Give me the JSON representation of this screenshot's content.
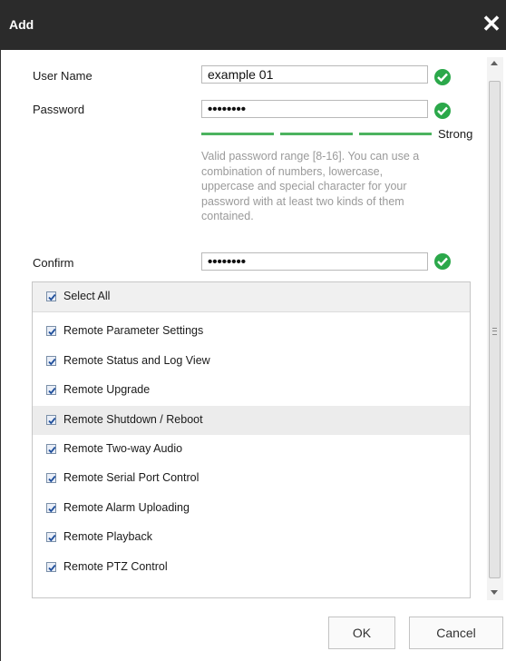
{
  "dialog": {
    "title": "Add",
    "close_glyph": "✕"
  },
  "form": {
    "user_name": {
      "label": "User Name",
      "value": "example 01",
      "status_icon": "check-circle-icon"
    },
    "password": {
      "label": "Password",
      "value": "••••••••",
      "status_icon": "check-circle-icon"
    },
    "strength": {
      "label": "Strong",
      "level": 1.0,
      "color": "#4cb35f"
    },
    "hint": "Valid password range [8-16]. You can use a combination of numbers, lowercase, uppercase and special character for your password with at least two kinds of them contained.",
    "confirm": {
      "label": "Confirm",
      "value": "••••••••",
      "status_icon": "check-circle-icon"
    }
  },
  "permissions": {
    "select_all": {
      "label": "Select All",
      "checked": true
    },
    "items": [
      {
        "label": "Remote Parameter Settings",
        "checked": true
      },
      {
        "label": "Remote Status and Log View",
        "checked": true
      },
      {
        "label": "Remote Upgrade",
        "checked": true
      },
      {
        "label": "Remote Shutdown / Reboot",
        "checked": true,
        "highlighted": true
      },
      {
        "label": "Remote Two-way Audio",
        "checked": true
      },
      {
        "label": "Remote Serial Port Control",
        "checked": true
      },
      {
        "label": "Remote Alarm Uploading",
        "checked": true
      },
      {
        "label": "Remote Playback",
        "checked": true
      },
      {
        "label": "Remote PTZ Control",
        "checked": true
      }
    ]
  },
  "buttons": {
    "ok": "OK",
    "cancel": "Cancel"
  },
  "colors": {
    "titlebar": "#2b2b2b",
    "success": "#2ba84a",
    "checkbox_mark": "#1f4f9c"
  }
}
